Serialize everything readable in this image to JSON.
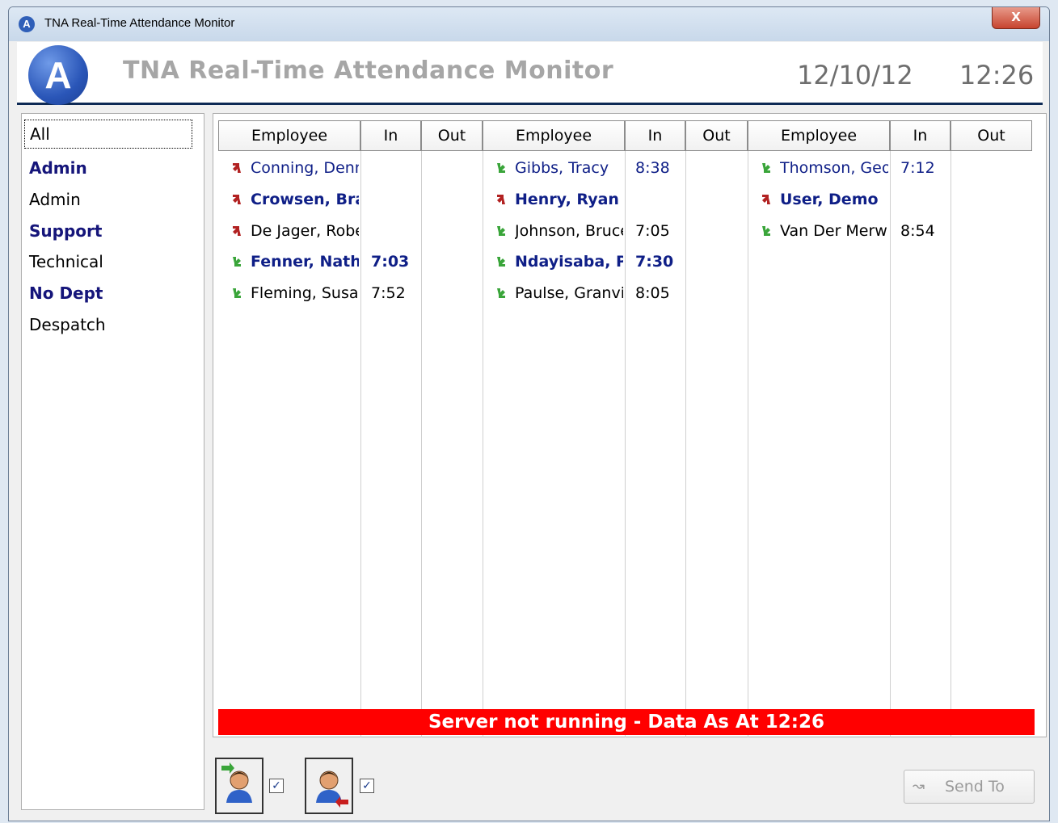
{
  "window": {
    "title": "TNA Real-Time Attendance Monitor",
    "close_glyph": "X",
    "icon_letter": "A"
  },
  "header": {
    "logo_letter": "A",
    "title": "TNA Real-Time Attendance Monitor",
    "date": "12/10/12",
    "time": "12:26"
  },
  "departments": [
    {
      "label": "All",
      "style": "selected"
    },
    {
      "label": "Admin",
      "style": "bold"
    },
    {
      "label": "Admin",
      "style": "normal"
    },
    {
      "label": "Support",
      "style": "bold"
    },
    {
      "label": "Technical",
      "style": "normal"
    },
    {
      "label": "No Dept",
      "style": "bold"
    },
    {
      "label": "Despatch",
      "style": "normal"
    }
  ],
  "grid": {
    "headers": [
      "Employee",
      "In",
      "Out",
      "Employee",
      "In",
      "Out",
      "Employee",
      "In",
      "Out"
    ],
    "columns": [
      {
        "rows": [
          {
            "name": "Conning, Denn",
            "in": "",
            "out": "",
            "status": "out",
            "style": "blue"
          },
          {
            "name": "Crowsen, Bra",
            "in": "",
            "out": "",
            "status": "out",
            "style": "boldblue"
          },
          {
            "name": "De Jager, Robe",
            "in": "",
            "out": "",
            "status": "out",
            "style": "plain"
          },
          {
            "name": "Fenner, Nath:",
            "in": "7:03",
            "out": "",
            "status": "in",
            "style": "boldblue"
          },
          {
            "name": "Fleming, Susar",
            "in": "7:52",
            "out": "",
            "status": "in",
            "style": "plain"
          }
        ]
      },
      {
        "rows": [
          {
            "name": "Gibbs, Tracy",
            "in": "8:38",
            "out": "",
            "status": "in",
            "style": "blue"
          },
          {
            "name": "Henry, Ryan",
            "in": "",
            "out": "",
            "status": "out",
            "style": "boldblue"
          },
          {
            "name": "Johnson, Bruce",
            "in": "7:05",
            "out": "",
            "status": "in",
            "style": "plain"
          },
          {
            "name": "Ndayisaba, Pı",
            "in": "7:30",
            "out": "",
            "status": "in",
            "style": "boldblue"
          },
          {
            "name": "Paulse, Granvil",
            "in": "8:05",
            "out": "",
            "status": "in",
            "style": "plain"
          }
        ]
      },
      {
        "rows": [
          {
            "name": "Thomson, Geo",
            "in": "7:12",
            "out": "",
            "status": "in",
            "style": "blue"
          },
          {
            "name": "User, Demo",
            "in": "",
            "out": "",
            "status": "out",
            "style": "boldblue"
          },
          {
            "name": "Van Der Merwı",
            "in": "8:54",
            "out": "",
            "status": "in",
            "style": "plain"
          }
        ]
      }
    ]
  },
  "status_bar": {
    "text": "Server not running - Data As At 12:26",
    "color": "#ff0000"
  },
  "toolbar": {
    "show_in": {
      "checked": true,
      "check_glyph": "✓"
    },
    "show_out": {
      "checked": true,
      "check_glyph": "✓"
    },
    "send_to": {
      "label": "Send To",
      "enabled": false
    }
  },
  "colors": {
    "in_arrow": "#3aa53a",
    "out_arrow": "#b22222",
    "name_blue": "#0f1f87"
  }
}
